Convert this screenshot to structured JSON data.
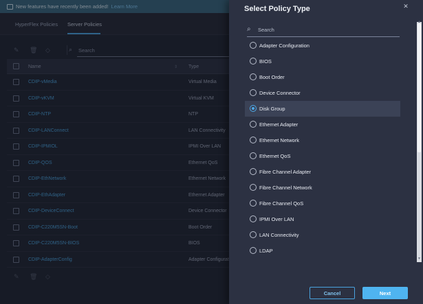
{
  "banner": {
    "text": "New features have recently been added!",
    "link": "Learn More"
  },
  "tabs": [
    {
      "label": "HyperFlex Policies"
    },
    {
      "label": "Server Policies"
    }
  ],
  "toolbar": {
    "search_placeholder": "Search"
  },
  "table": {
    "headers": {
      "name": "Name",
      "type": "Type"
    },
    "rows": [
      {
        "name": "CDIP-vMedia",
        "type": "Virtual Media"
      },
      {
        "name": "CDIP-vKVM",
        "type": "Virtual KVM"
      },
      {
        "name": "CDIP-NTP",
        "type": "NTP"
      },
      {
        "name": "CDIP-LANConnect",
        "type": "LAN Connectivity"
      },
      {
        "name": "CDIP-IPMIOL",
        "type": "IPMI Over LAN"
      },
      {
        "name": "CDIP-QOS",
        "type": "Ethernet QoS"
      },
      {
        "name": "CDIP-EthNetwork",
        "type": "Ethernet Network"
      },
      {
        "name": "CDIP-EthAdapter",
        "type": "Ethernet Adapter"
      },
      {
        "name": "CDIP-DeviceConnect",
        "type": "Device Connector"
      },
      {
        "name": "CDIP-C220M5SN-Boot",
        "type": "Boot Order"
      },
      {
        "name": "CDIP-C220M5SN-BIOS",
        "type": "BIOS"
      },
      {
        "name": "CDIP-AdapterConfig",
        "type": "Adapter Configurati"
      }
    ]
  },
  "panel": {
    "title": "Select Policy Type",
    "search_placeholder": "Search",
    "options": [
      {
        "label": "Adapter Configuration"
      },
      {
        "label": "BIOS"
      },
      {
        "label": "Boot Order"
      },
      {
        "label": "Device Connector"
      },
      {
        "label": "Disk Group"
      },
      {
        "label": "Ethernet Adapter"
      },
      {
        "label": "Ethernet Network"
      },
      {
        "label": "Ethernet QoS"
      },
      {
        "label": "Fibre Channel Adapter"
      },
      {
        "label": "Fibre Channel Network"
      },
      {
        "label": "Fibre Channel QoS"
      },
      {
        "label": "IPMI Over LAN"
      },
      {
        "label": "LAN Connectivity"
      },
      {
        "label": "LDAP"
      }
    ],
    "selected": "Disk Group",
    "cancel_label": "Cancel",
    "next_label": "Next"
  },
  "colors": {
    "accent": "#4fb4f0",
    "link": "#4a9fd8",
    "panel_bg": "#2c3142",
    "page_bg": "#222634"
  }
}
